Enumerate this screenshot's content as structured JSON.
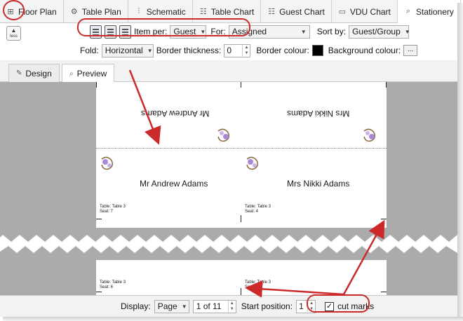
{
  "tabs": [
    {
      "label": "Floor Plan",
      "icon": "floor-plan-icon",
      "active": false
    },
    {
      "label": "Table Plan",
      "icon": "table-plan-icon",
      "active": false
    },
    {
      "label": "Schematic",
      "icon": "schematic-icon",
      "active": false
    },
    {
      "label": "Table Chart",
      "icon": "table-chart-icon",
      "active": false
    },
    {
      "label": "Guest Chart",
      "icon": "guest-chart-icon",
      "active": false
    },
    {
      "label": "VDU Chart",
      "icon": "vdu-chart-icon",
      "active": false
    },
    {
      "label": "Stationery",
      "icon": "stationery-icon",
      "active": true
    }
  ],
  "ribbon": {
    "less_label": "less",
    "item_per_label": "Item per:",
    "item_per_value": "Guest",
    "for_label": "For:",
    "for_value": "Assigned",
    "sort_by_label": "Sort by:",
    "sort_by_value": "Guest/Group",
    "fold_label": "Fold:",
    "fold_value": "Horizontal",
    "border_thickness_label": "Border thickness:",
    "border_thickness_value": "0",
    "border_colour_label": "Border colour:",
    "border_colour": "#000000",
    "background_colour_label": "Background colour:",
    "background_colour_button": "..."
  },
  "subtabs": [
    {
      "label": "Design",
      "icon": "design-icon",
      "active": false
    },
    {
      "label": "Preview",
      "icon": "preview-icon",
      "active": true
    }
  ],
  "preview": {
    "cards_top": [
      {
        "name": "Mr Andrew Adams",
        "table": "Table: Table 3",
        "seat": "Seat: 7"
      },
      {
        "name": "Mrs Nikki Adams",
        "table": "Table: Table 3",
        "seat": "Seat: 4"
      }
    ],
    "cards_bottom": [
      {
        "table": "Table: Table 3",
        "seat": "Seat: 6"
      },
      {
        "table": "Table: Table 3",
        "seat": "Seat: 1"
      }
    ]
  },
  "statusbar": {
    "display_label": "Display:",
    "display_value": "Page",
    "page_value": "1 of 11",
    "start_position_label": "Start position:",
    "start_position_value": "1",
    "cut_marks_label": "cut marks",
    "cut_marks_checked": "✓"
  },
  "colors": {
    "annotation_red": "#cc2a2a",
    "preview_background": "#ababab"
  }
}
